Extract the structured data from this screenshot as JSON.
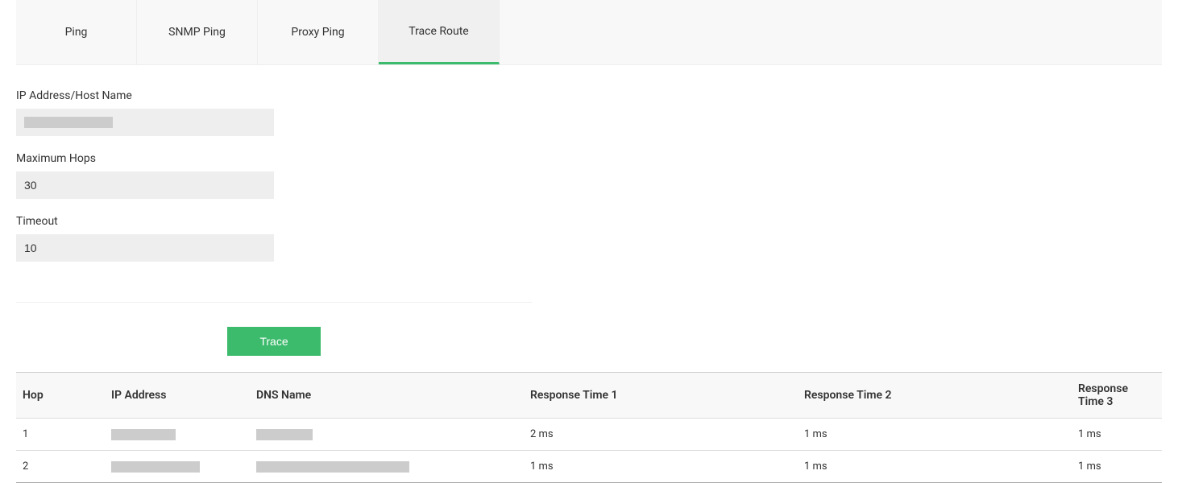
{
  "tabs": [
    {
      "label": "Ping",
      "active": false
    },
    {
      "label": "SNMP Ping",
      "active": false
    },
    {
      "label": "Proxy Ping",
      "active": false
    },
    {
      "label": "Trace Route",
      "active": true
    }
  ],
  "form": {
    "ip_label": "IP Address/Host Name",
    "ip_value": "",
    "max_hops_label": "Maximum Hops",
    "max_hops_value": "30",
    "timeout_label": "Timeout",
    "timeout_value": "10"
  },
  "buttons": {
    "trace": "Trace"
  },
  "table": {
    "headers": {
      "hop": "Hop",
      "ip": "IP Address",
      "dns": "DNS Name",
      "rt1": "Response Time 1",
      "rt2": "Response Time 2",
      "rt3": "Response Time 3"
    },
    "rows": [
      {
        "hop": "1",
        "ip": "",
        "dns": "",
        "rt1": "2 ms",
        "rt2": "1 ms",
        "rt3": "1 ms"
      },
      {
        "hop": "2",
        "ip": "",
        "dns": "",
        "rt1": "1 ms",
        "rt2": "1 ms",
        "rt3": "1 ms"
      }
    ]
  }
}
